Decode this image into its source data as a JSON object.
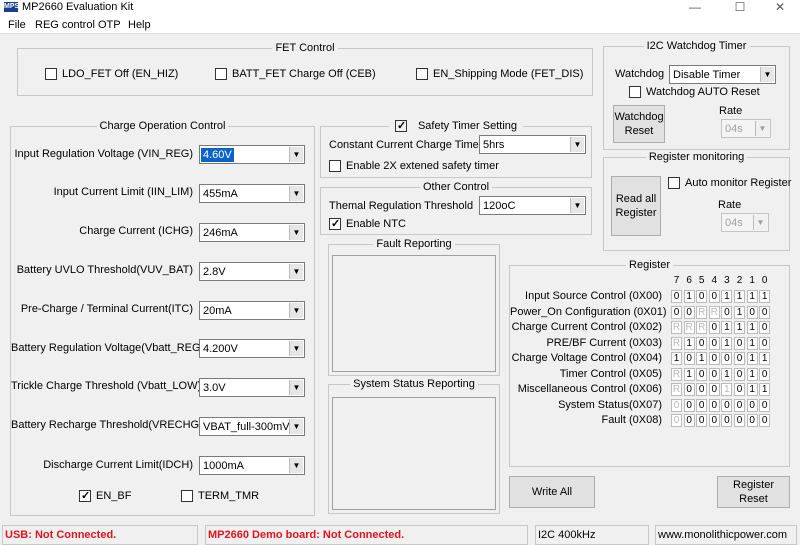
{
  "window": {
    "title": "MP2660  Evaluation Kit",
    "logo_text": "MPS"
  },
  "menu": [
    "File",
    "REG control",
    "OTP",
    "Help"
  ],
  "fet_control": {
    "title": "FET Control",
    "checks": [
      {
        "label": "LDO_FET Off (EN_HIZ)",
        "checked": false
      },
      {
        "label": "BATT_FET Charge Off (CEB)",
        "checked": false
      },
      {
        "label": "EN_Shipping Mode (FET_DIS)",
        "checked": false
      }
    ]
  },
  "i2c_watchdog": {
    "title": "I2C Watchdog Timer",
    "watchdog_label": "Watchdog",
    "watchdog_value": "Disable Timer",
    "auto_reset_label": "Watchdog AUTO Reset",
    "auto_reset_checked": false,
    "reset_button": "Watchdog Reset",
    "rate_label": "Rate",
    "rate_value": "04s"
  },
  "charge_op": {
    "title": "Charge Operation Control",
    "rows": [
      {
        "label": "Input Regulation Voltage (VIN_REG)",
        "value": "4.60V"
      },
      {
        "label": "Input Current Limit (IIN_LIM)",
        "value": "455mA"
      },
      {
        "label": "Charge Current (ICHG)",
        "value": "246mA"
      },
      {
        "label": "Battery UVLO Threshold(VUV_BAT)",
        "value": "2.8V"
      },
      {
        "label": "Pre-Charge / Terminal Current(ITC)",
        "value": "20mA"
      },
      {
        "label": "Battery Regulation Voltage(Vbatt_REG)",
        "value": "4.200V"
      },
      {
        "label": "Trickle Charge Threshold (Vbatt_LOW)",
        "value": "3.0V"
      },
      {
        "label": "Battery Recharge Threshold(VRECHG)",
        "value": "VBAT_full-300mV"
      },
      {
        "label": "Discharge Current Limit(IDCH)",
        "value": "1000mA"
      }
    ],
    "en_bf_label": "EN_BF",
    "en_bf_checked": true,
    "term_tmr_label": "TERM_TMR",
    "term_tmr_checked": false
  },
  "safety_timer": {
    "title": "Safety Timer Setting",
    "title_checked": true,
    "cc_timer_label": "Constant Current Charge Timer",
    "cc_timer_value": "5hrs",
    "enable_2x_label": "Enable 2X extened safety timer",
    "enable_2x_checked": false
  },
  "other_control": {
    "title": "Other Control",
    "thermal_label": "Themal Regulation Threshold",
    "thermal_value": "120oC",
    "enable_ntc_label": "Enable NTC",
    "enable_ntc_checked": true
  },
  "fault_reporting": {
    "title": "Fault Reporting"
  },
  "system_status": {
    "title": "System Status Reporting"
  },
  "register_monitoring": {
    "title": "Register monitoring",
    "read_button": "Read all Register",
    "auto_monitor_label": "Auto monitor Register",
    "auto_monitor_checked": false,
    "rate_label": "Rate",
    "rate_value": "04s"
  },
  "register": {
    "title": "Register",
    "bit_headers": [
      "7",
      "6",
      "5",
      "4",
      "3",
      "2",
      "1",
      "0"
    ],
    "rows": [
      {
        "label": "Input Source Control (0X00)",
        "bits": [
          "0",
          "1",
          "0",
          "0",
          "1",
          "1",
          "1",
          "1"
        ],
        "dim": []
      },
      {
        "label": "Power_On Configuration (0X01)",
        "bits": [
          "0",
          "0",
          "R",
          "R",
          "0",
          "1",
          "0",
          "0"
        ],
        "dim": [
          2,
          3
        ]
      },
      {
        "label": "Charge Current Control (0X02)",
        "bits": [
          "R",
          "R",
          "R",
          "0",
          "1",
          "1",
          "1",
          "0"
        ],
        "dim": [
          0,
          1,
          2
        ]
      },
      {
        "label": "PRE/BF Current (0X03)",
        "bits": [
          "R",
          "1",
          "0",
          "0",
          "1",
          "0",
          "1",
          "0"
        ],
        "dim": [
          0
        ]
      },
      {
        "label": "Charge Voltage Control (0X04)",
        "bits": [
          "1",
          "0",
          "1",
          "0",
          "0",
          "0",
          "1",
          "1"
        ],
        "dim": []
      },
      {
        "label": "Timer Control (0X05)",
        "bits": [
          "R",
          "1",
          "0",
          "0",
          "1",
          "0",
          "1",
          "0"
        ],
        "dim": [
          0
        ]
      },
      {
        "label": "Miscellaneous Control (0X06)",
        "bits": [
          "R",
          "0",
          "0",
          "0",
          "1",
          "0",
          "1",
          "1"
        ],
        "dim": [
          0,
          4
        ]
      },
      {
        "label": "System Status(0X07)",
        "bits": [
          "0",
          "0",
          "0",
          "0",
          "0",
          "0",
          "0",
          "0"
        ],
        "dim": [
          0
        ]
      },
      {
        "label": "Fault (0X08)",
        "bits": [
          "0",
          "0",
          "0",
          "0",
          "0",
          "0",
          "0",
          "0"
        ],
        "dim": [
          0
        ]
      }
    ]
  },
  "buttons": {
    "write_all": "Write All",
    "register_reset": "Register Reset"
  },
  "statusbar": {
    "usb": "USB: Not Connected.",
    "demo": "MP2660 Demo board: Not Connected.",
    "i2c": "I2C 400kHz",
    "url": "www.monolithicpower.com"
  }
}
